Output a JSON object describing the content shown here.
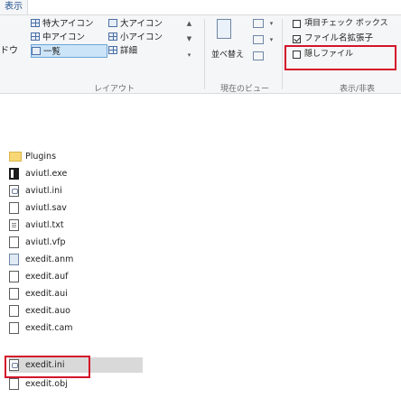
{
  "tabs": {
    "view": "表示"
  },
  "ribbon": {
    "pane_cut_label": "ドウ",
    "layout": {
      "items_col1": [
        {
          "label": "特大アイコン",
          "icon": "large-icons-icon"
        },
        {
          "label": "中アイコン",
          "icon": "medium-icons-icon"
        },
        {
          "label": "一覧",
          "icon": "list-icon"
        }
      ],
      "items_col2": [
        {
          "label": "大アイコン",
          "icon": "large-icons-icon"
        },
        {
          "label": "小アイコン",
          "icon": "small-icons-icon"
        },
        {
          "label": "詳細",
          "icon": "details-icon"
        }
      ],
      "group_label": "レイアウト"
    },
    "current_view": {
      "sort_label": "並べ替え",
      "group_label": "現在のビュー"
    },
    "show_hide": {
      "item_checkboxes": {
        "label": "項目チェック ボックス",
        "checked": false
      },
      "file_extensions": {
        "label": "ファイル名拡張子",
        "checked": true
      },
      "hidden_items": {
        "label": "隠しファイル",
        "checked": false
      },
      "group_label": "表示/非表"
    },
    "highlight_color": "#d4142a",
    "selected_layout": "一覧"
  },
  "files": [
    {
      "name": "Plugins",
      "type": "folder"
    },
    {
      "name": "aviutl.exe",
      "type": "exe"
    },
    {
      "name": "aviutl.ini",
      "type": "ini"
    },
    {
      "name": "aviutl.sav",
      "type": "doc"
    },
    {
      "name": "aviutl.txt",
      "type": "txt"
    },
    {
      "name": "aviutl.vfp",
      "type": "doc"
    },
    {
      "name": "exedit.anm",
      "type": "anm"
    },
    {
      "name": "exedit.auf",
      "type": "doc"
    },
    {
      "name": "exedit.aui",
      "type": "doc"
    },
    {
      "name": "exedit.auo",
      "type": "doc"
    },
    {
      "name": "exedit.cam",
      "type": "doc"
    },
    {
      "name": "exedit.ini",
      "type": "ini",
      "selected": true
    },
    {
      "name": "exedit.obj",
      "type": "doc"
    }
  ]
}
